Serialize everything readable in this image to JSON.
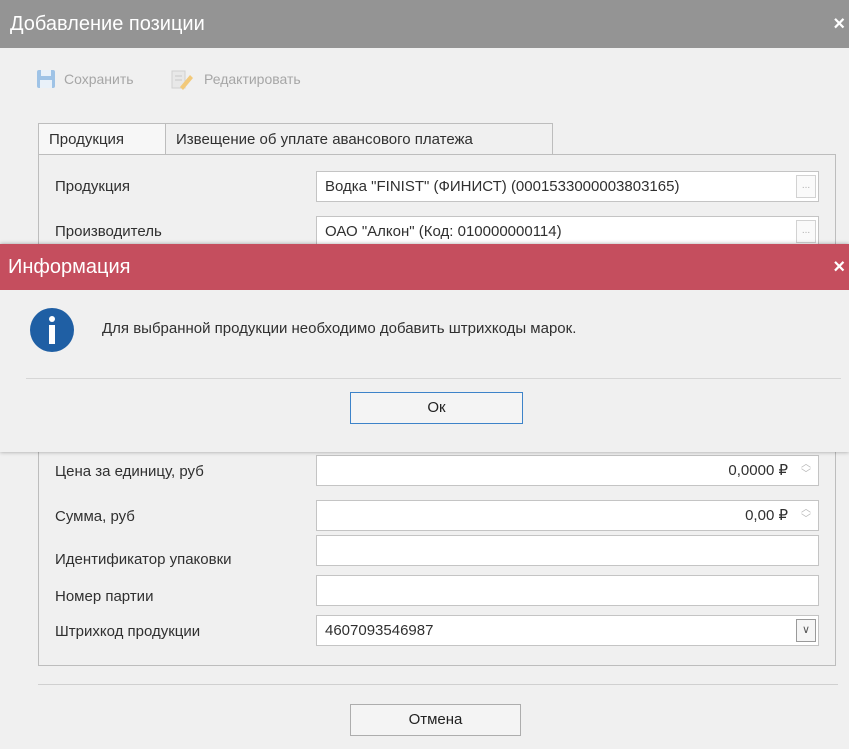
{
  "window": {
    "title": "Добавление позиции",
    "close_glyph": "×"
  },
  "toolbar": {
    "save_label": "Сохранить",
    "edit_label": "Редактировать",
    "save_icon": "floppy-disk-icon",
    "edit_icon": "pencil-document-icon"
  },
  "tabs": [
    {
      "label": "Продукция",
      "active": true
    },
    {
      "label": "Извещение об уплате авансового платежа",
      "active": false
    }
  ],
  "form": {
    "product": {
      "label": "Продукция",
      "value": "Водка \"FINIST\" (ФИНИСТ) (0001533000003803165)",
      "button": "..."
    },
    "producer": {
      "label": "Производитель",
      "value": "ОАО \"Алкон\" (Код: 010000000114)",
      "button": "..."
    },
    "unit_price": {
      "label": "Цена за единицу, руб",
      "value": "0,0000 ₽"
    },
    "sum": {
      "label": "Сумма, руб",
      "value": "0,00 ₽"
    },
    "package_id": {
      "label": "Идентификатор упаковки",
      "value": ""
    },
    "batch_number": {
      "label": "Номер партии",
      "value": ""
    },
    "barcode": {
      "label": "Штрихкод продукции",
      "value": "4607093546987"
    }
  },
  "cancel_label": "Отмена",
  "modal": {
    "title": "Информация",
    "close_glyph": "×",
    "message": "Для выбранной продукции необходимо добавить штрихкоды марок.",
    "ok_label": "Ок",
    "icon": "info-icon"
  },
  "colors": {
    "window_title_bar": "#949494",
    "modal_title_bar": "#c54e5e",
    "info_icon": "#1f5fa4",
    "ok_border": "#3d83c9"
  }
}
